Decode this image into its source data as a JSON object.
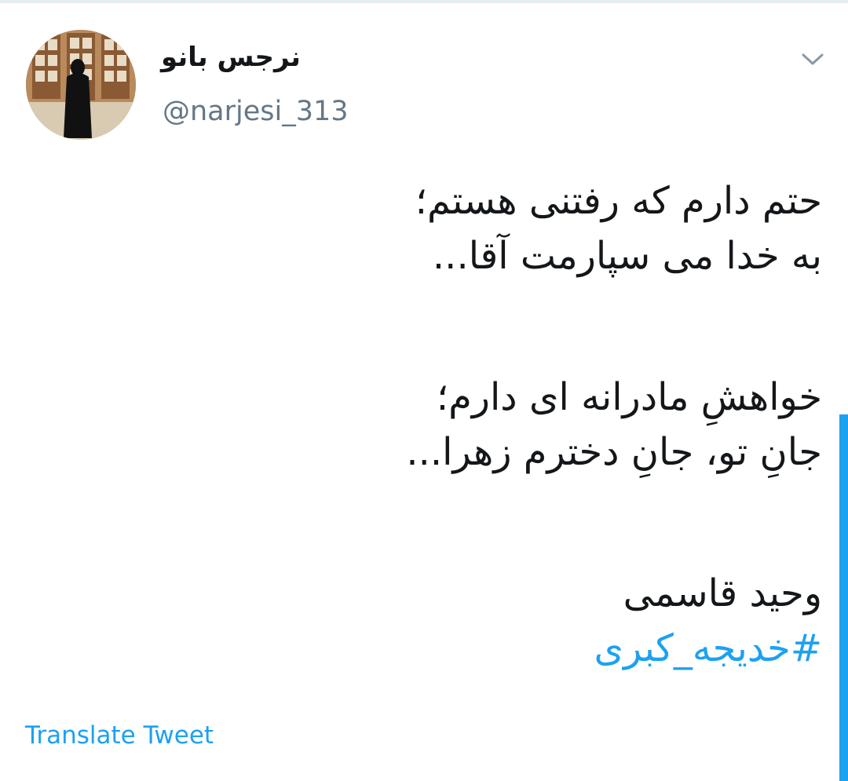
{
  "user": {
    "display_name": "نرجس بانو",
    "handle": "@narjesi_313",
    "avatar_icon": "profile-photo"
  },
  "menu": {
    "caret_icon": "chevron-down-icon"
  },
  "tweet": {
    "lines": [
      "حتم دارم که رفتنی هستم؛",
      "به خدا می سپارمت آقا...",
      "خواهشِ مادرانه ای دارم؛",
      "جانِ تو، جانِ دخترم زهرا...",
      "وحید قاسمی"
    ],
    "hashtag": "#خدیجه_کبری"
  },
  "actions": {
    "translate_label": "Translate Tweet"
  },
  "colors": {
    "link": "#1da1f2",
    "text": "#14171a",
    "secondary": "#657786",
    "divider": "#e6ecf0"
  }
}
